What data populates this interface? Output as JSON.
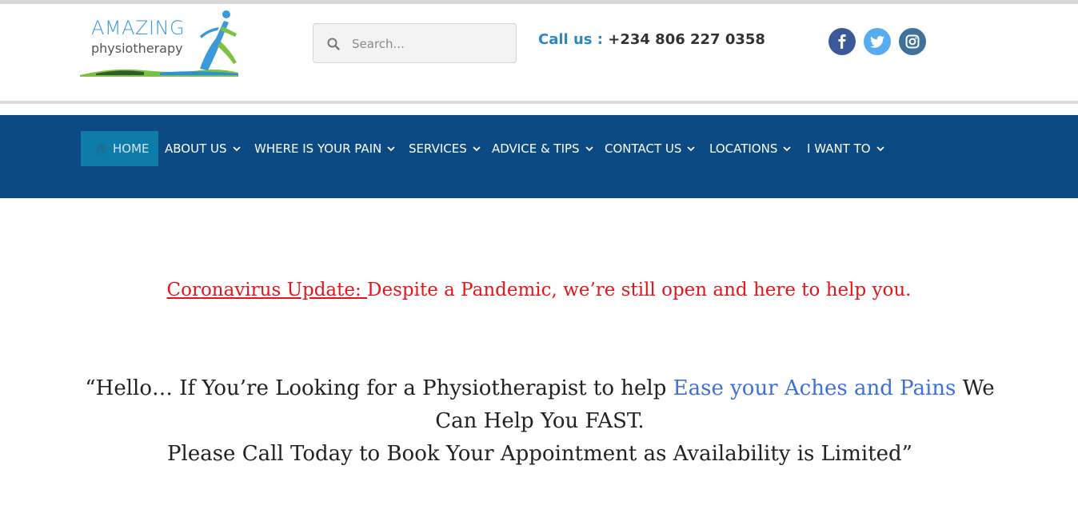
{
  "header": {
    "logo": {
      "line1": "AMAZING",
      "line2": "physiotherapy"
    },
    "search": {
      "placeholder": "Search..."
    },
    "call": {
      "label": "Call us :",
      "number": "+234 806 227 0358"
    },
    "social": [
      {
        "icon": "facebook-icon"
      },
      {
        "icon": "twitter-icon"
      },
      {
        "icon": "instagram-icon"
      }
    ]
  },
  "nav": {
    "items": [
      {
        "label": "HOME",
        "icon": "home-icon",
        "active": true
      },
      {
        "label": "ABOUT US",
        "dropdown": true
      },
      {
        "label": "WHERE IS YOUR PAIN",
        "dropdown": true
      },
      {
        "label": "SERVICES",
        "dropdown": true
      },
      {
        "label": "ADVICE & TIPS",
        "dropdown": true
      },
      {
        "label": "CONTACT US",
        "dropdown": true
      },
      {
        "label": "LOCATIONS",
        "dropdown": true
      },
      {
        "label": "I WANT TO",
        "dropdown": true
      }
    ]
  },
  "main": {
    "covid_link": "Coronavirus Update: ",
    "covid_text": "Despite a Pandemic, we’re still open and here to help you.",
    "hello_part1": "“Hello… If You’re Looking for a Physiotherapist to help ",
    "hello_highlight": "Ease your Aches and Pains",
    "hello_part2": " We Can Help You FAST.",
    "hello_line2": "Please Call Today to Book Your Appointment as Availability is Limited”"
  },
  "colors": {
    "nav_bg": "#0b4a82",
    "nav_active": "#0e7ba8",
    "accent_blue": "#2a88c4",
    "alert_red": "#e8141b",
    "highlight_blue": "#3f6fd8"
  }
}
